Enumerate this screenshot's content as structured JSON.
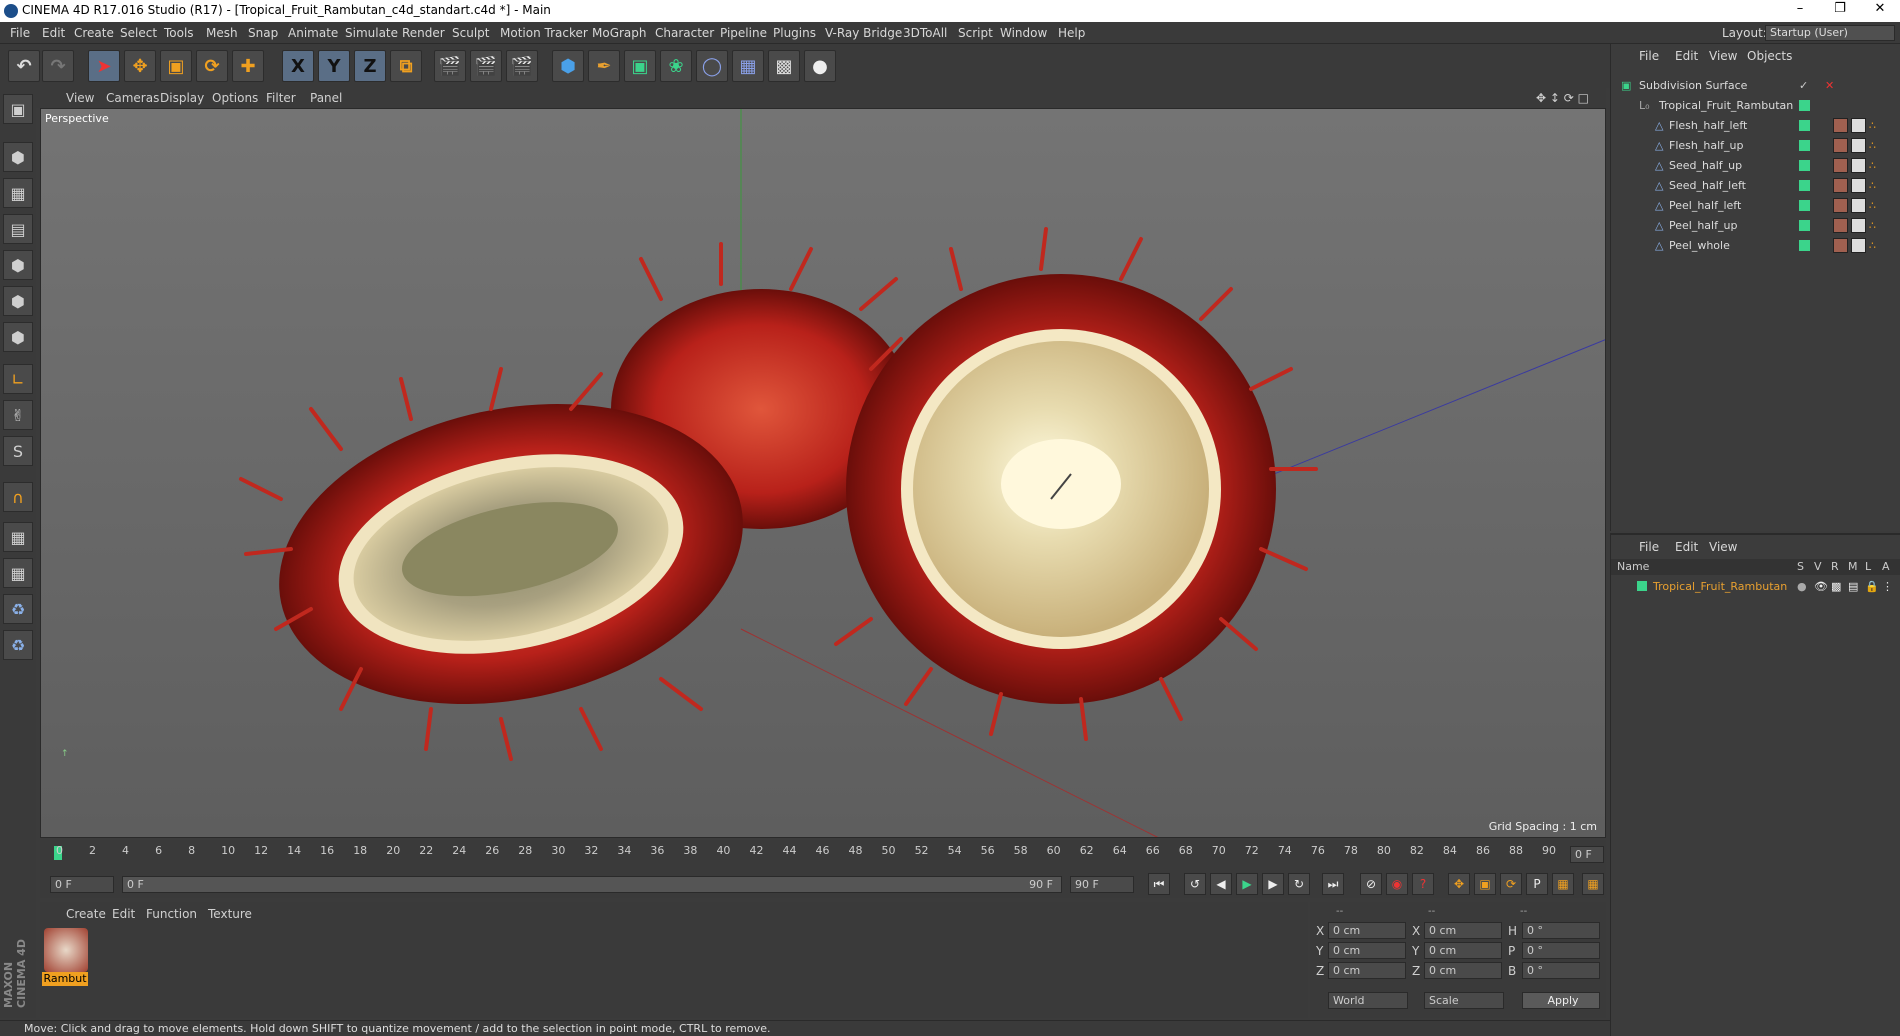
{
  "window": {
    "title": "CINEMA 4D R17.016 Studio (R17) - [Tropical_Fruit_Rambutan_c4d_standart.c4d *] - Main"
  },
  "menubar": [
    "File",
    "Edit",
    "Create",
    "Select",
    "Tools",
    "Mesh",
    "Snap",
    "Animate",
    "Simulate",
    "Render",
    "Sculpt",
    "Motion Tracker",
    "MoGraph",
    "Character",
    "Pipeline",
    "Plugins",
    "V-Ray Bridge",
    "3DToAll",
    "Script",
    "Window",
    "Help"
  ],
  "layout": {
    "label": "Layout:",
    "value": "Startup (User)"
  },
  "viewport": {
    "menu": [
      "View",
      "Cameras",
      "Display",
      "Options",
      "Filter",
      "Panel"
    ],
    "label": "Perspective",
    "grid_spacing": "Grid Spacing : 1 cm"
  },
  "timeline": {
    "ticks": [
      "0",
      "2",
      "4",
      "6",
      "8",
      "10",
      "12",
      "14",
      "16",
      "18",
      "20",
      "22",
      "24",
      "26",
      "28",
      "30",
      "32",
      "34",
      "36",
      "38",
      "40",
      "42",
      "44",
      "46",
      "48",
      "50",
      "52",
      "54",
      "56",
      "58",
      "60",
      "62",
      "64",
      "66",
      "68",
      "70",
      "72",
      "74",
      "76",
      "78",
      "80",
      "82",
      "84",
      "86",
      "88",
      "90"
    ],
    "current_frame": "0 F",
    "end_frame_field": "0 F",
    "start_field": "0 F",
    "range_start": "0 F",
    "range_end": "90 F",
    "max_field": "90 F"
  },
  "material_panel": {
    "menu": [
      "Create",
      "Edit",
      "Function",
      "Texture"
    ],
    "materials": [
      {
        "name": "Rambut"
      }
    ]
  },
  "coord_panel": {
    "headers": [
      "--",
      "--",
      "--"
    ],
    "rows": [
      {
        "a": "X",
        "av": "0 cm",
        "b": "X",
        "bv": "0 cm",
        "c": "H",
        "cv": "0 °"
      },
      {
        "a": "Y",
        "av": "0 cm",
        "b": "Y",
        "bv": "0 cm",
        "c": "P",
        "cv": "0 °"
      },
      {
        "a": "Z",
        "av": "0 cm",
        "b": "Z",
        "bv": "0 cm",
        "c": "B",
        "cv": "0 °"
      }
    ],
    "mode1": "World",
    "mode2": "Scale",
    "apply": "Apply"
  },
  "status": "Move: Click and drag to move elements. Hold down SHIFT to quantize movement / add to the selection in point mode, CTRL to remove.",
  "object_manager": {
    "menu": [
      "File",
      "Edit",
      "View",
      "Objects"
    ],
    "objects": [
      {
        "name": "Subdivision Surface",
        "level": 0
      },
      {
        "name": "Tropical_Fruit_Rambutan",
        "level": 1
      },
      {
        "name": "Flesh_half_left",
        "level": 2
      },
      {
        "name": "Flesh_half_up",
        "level": 2
      },
      {
        "name": "Seed_half_up",
        "level": 2
      },
      {
        "name": "Seed_half_left",
        "level": 2
      },
      {
        "name": "Peel_half_left",
        "level": 2
      },
      {
        "name": "Peel_half_up",
        "level": 2
      },
      {
        "name": "Peel_whole",
        "level": 2
      }
    ]
  },
  "layer_manager": {
    "menu": [
      "File",
      "Edit",
      "View"
    ],
    "columns": [
      "Name",
      "S",
      "V",
      "R",
      "M",
      "L",
      "A"
    ],
    "rows": [
      {
        "name": "Tropical_Fruit_Rambutan"
      }
    ]
  },
  "brand": "MAXON CINEMA 4D",
  "colors": {
    "accent_green": "#3bd48b",
    "selected_orange": "#f0a020",
    "layer_orange": "#e8a030"
  }
}
